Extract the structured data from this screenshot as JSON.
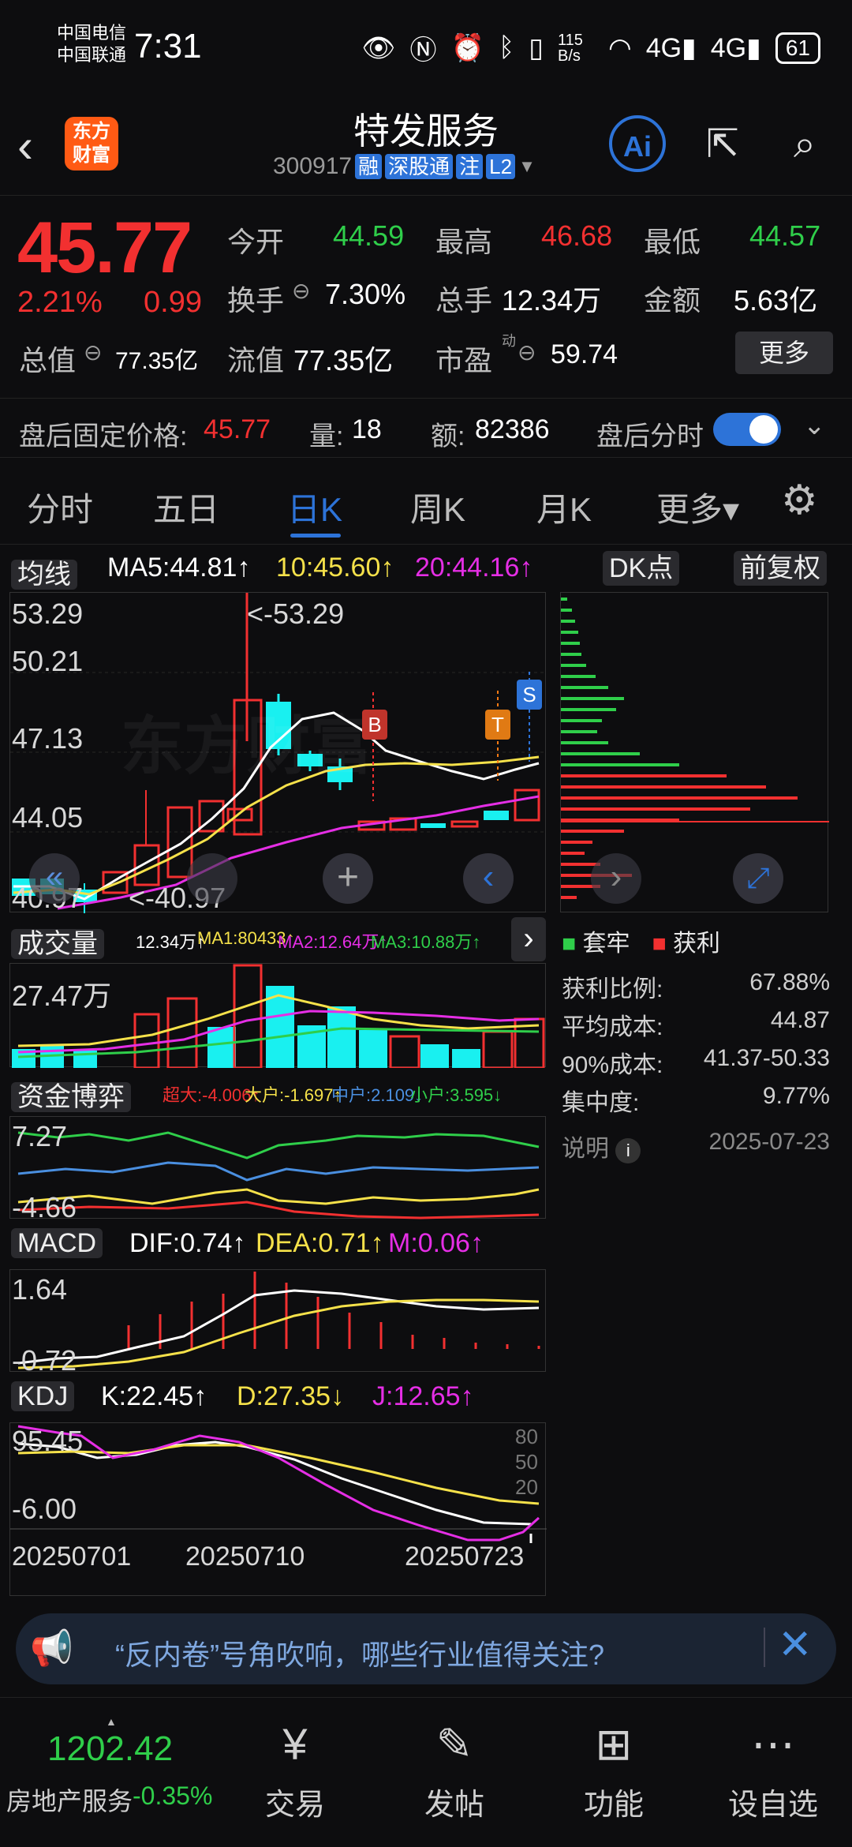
{
  "status_bar": {
    "carrier1": "中国电信",
    "carrier2": "中国联通",
    "time": "7:31",
    "net_speed": "115 B/s",
    "battery": "61"
  },
  "header": {
    "logo_text": "东方财富",
    "title": "特发服务",
    "code": "300917",
    "tags": [
      "融",
      "深股通",
      "注",
      "L2"
    ]
  },
  "quote": {
    "price": "45.77",
    "pct": "2.21%",
    "change": "0.99",
    "open_label": "今开",
    "open": "44.59",
    "high_label": "最高",
    "high": "46.68",
    "low_label": "最低",
    "low": "44.57",
    "turnover_label": "换手",
    "turnover": "7.30%",
    "volume_label": "总手",
    "volume": "12.34万",
    "amount_label": "金额",
    "amount": "5.63亿",
    "mcap_label": "总值",
    "mcap": "77.35亿",
    "float_label": "流值",
    "float": "77.35亿",
    "pe_label": "市盈",
    "pe_sup": "动",
    "pe": "59.74",
    "more": "更多"
  },
  "after_hours": {
    "price_label": "盘后固定价格:",
    "price": "45.77",
    "vol_label": "量:",
    "vol": "18",
    "amt_label": "额:",
    "amt": "82386",
    "toggle_label": "盘后分时"
  },
  "tabs": [
    "分时",
    "五日",
    "日K",
    "周K",
    "月K",
    "更多▾"
  ],
  "chart": {
    "ma_selector": "均线",
    "ma5": "MA5:44.81↑",
    "ma10": "10:45.60↑",
    "ma20": "20:44.16↑",
    "dk_btn": "DK点",
    "adjust_btn": "前复权",
    "y_ticks": [
      "53.29",
      "50.21",
      "47.13",
      "44.05",
      "40.97"
    ],
    "max_label": "<-53.29",
    "min_label": "<-40.97",
    "watermark": "东方财富",
    "markers": [
      "B",
      "T",
      "S"
    ],
    "vol_selector": "成交量",
    "vol_ind": [
      "12.34万↑",
      "MA1:80433↑",
      "MA2:12.64万↑",
      "MA3:10.88万↑"
    ],
    "vol_tick": "27.47万",
    "fund_selector": "资金博弈",
    "fund_ind": [
      "超大:-4.006↑",
      "大户:-1.697↑",
      "中户:2.109↓",
      "小户:3.595↓"
    ],
    "fund_ticks": [
      "7.27",
      "-4.66"
    ],
    "macd_selector": "MACD",
    "macd_ind": [
      "DIF:0.74↑",
      "DEA:0.71↑",
      "M:0.06↑"
    ],
    "macd_ticks": [
      "1.64",
      "-0.72"
    ],
    "kdj_selector": "KDJ",
    "kdj_ind": [
      "K:22.45↑",
      "D:27.35↓",
      "J:12.65↑"
    ],
    "kdj_ticks": [
      "95.45",
      "-6.00"
    ],
    "kdj_right_ticks": [
      "80",
      "50",
      "20"
    ],
    "dates": [
      "20250701",
      "20250710",
      "20250723"
    ]
  },
  "chips": {
    "legend_trap": "套牢",
    "legend_profit": "获利",
    "rows": [
      {
        "label": "获利比例:",
        "value": "67.88%"
      },
      {
        "label": "平均成本:",
        "value": "44.87"
      },
      {
        "label": "90%成本:",
        "value": "41.37-50.33"
      },
      {
        "label": "集中度:",
        "value": "9.77%"
      }
    ],
    "explain": "说明",
    "date": "2025-07-23"
  },
  "banner": {
    "text": "“反内卷”号角吹响，哪些行业值得关注?"
  },
  "bottom_nav": {
    "index_value": "1202.42",
    "index_name": "房地产服务",
    "index_change": "-0.35%",
    "items": [
      "交易",
      "发帖",
      "功能",
      "设自选"
    ]
  },
  "colors": {
    "red": "#f23030",
    "green": "#2fce4a",
    "accent": "#2d73d8",
    "yellow": "#f5e14a",
    "magenta": "#e52ee5",
    "cyan": "#19f0f0"
  }
}
